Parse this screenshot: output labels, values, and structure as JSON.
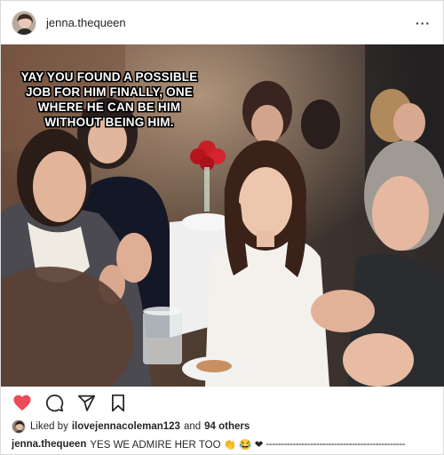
{
  "header": {
    "username": "jenna.thequeen",
    "more_label": "···"
  },
  "photo": {
    "meme_text": "YAY YOU FOUND A POSSIBLE JOB FOR HIM FINALLY, ONE WHERE HE CAN BE HIM WITHOUT BEING HIM."
  },
  "actions": {
    "like_icon": "heart-icon",
    "like_color": "#ed4956",
    "comment_icon": "comment-icon",
    "share_icon": "share-icon",
    "save_icon": "bookmark-icon"
  },
  "likes": {
    "prefix": "Liked by",
    "user": "ilovejennacoleman123",
    "joiner": "and",
    "others": "94 others"
  },
  "caption": {
    "username": "jenna.thequeen",
    "text": "YES WE ADMIRE HER TOO 👏 😂 ❤",
    "dashes": "-----------------------------------------------"
  }
}
